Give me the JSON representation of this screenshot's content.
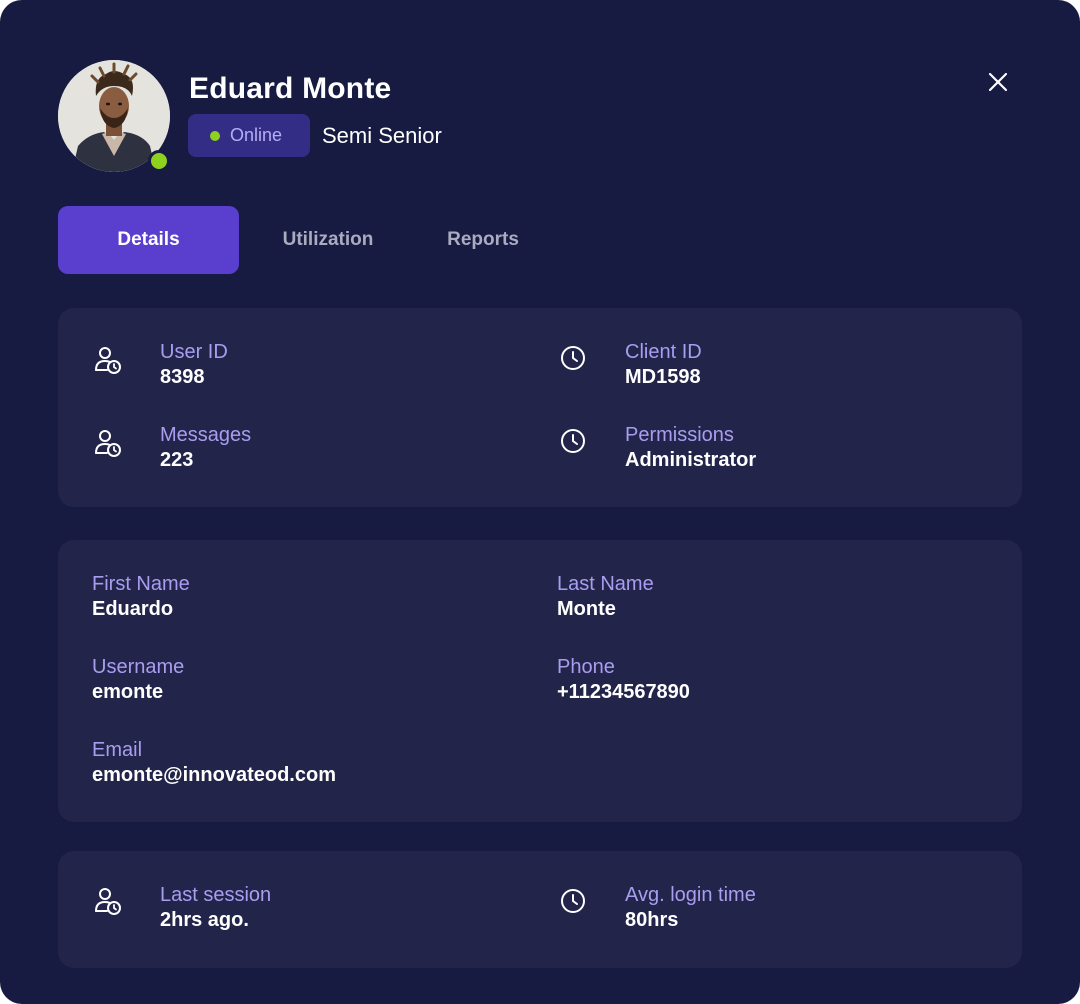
{
  "profile": {
    "name": "Eduard Monte",
    "status": "Online",
    "level": "Semi Senior",
    "status_color": "#8fd11f"
  },
  "tabs": [
    {
      "label": "Details",
      "active": true
    },
    {
      "label": "Utilization",
      "active": false
    },
    {
      "label": "Reports",
      "active": false
    }
  ],
  "ids_card": {
    "user_id": {
      "label": "User ID",
      "value": "8398",
      "icon": "user-clock-icon"
    },
    "client_id": {
      "label": "Client ID",
      "value": "MD1598",
      "icon": "clock-icon"
    },
    "messages": {
      "label": "Messages",
      "value": "223",
      "icon": "user-clock-icon"
    },
    "permissions": {
      "label": "Permissions",
      "value": "Administrator",
      "icon": "clock-icon"
    }
  },
  "personal_card": {
    "first_name": {
      "label": "First Name",
      "value": "Eduardo"
    },
    "last_name": {
      "label": "Last Name",
      "value": "Monte"
    },
    "username": {
      "label": "Username",
      "value": "emonte"
    },
    "phone": {
      "label": "Phone",
      "value": "+11234567890"
    },
    "email": {
      "label": "Email",
      "value": "emonte@innovateod.com"
    }
  },
  "session_card": {
    "last_session": {
      "label": "Last session",
      "value": "2hrs ago.",
      "icon": "user-clock-icon"
    },
    "avg_login": {
      "label": "Avg. login time",
      "value": "80hrs",
      "icon": "clock-icon"
    }
  },
  "colors": {
    "background": "#171a41",
    "card": "#22244a",
    "accent": "#5a3fcf",
    "label": "#a99df0"
  }
}
